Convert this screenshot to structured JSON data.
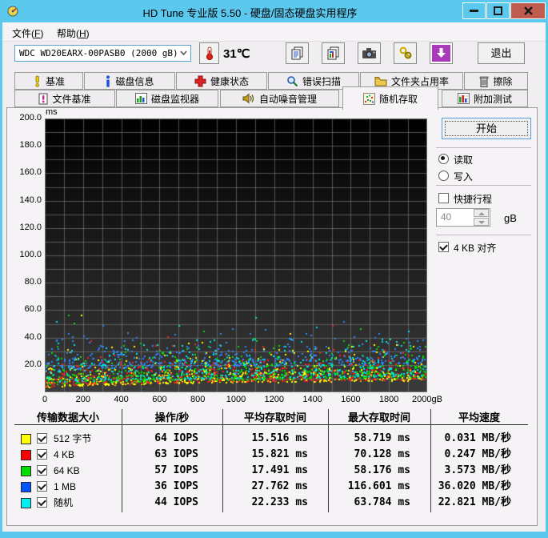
{
  "window": {
    "title": "HD Tune 专业版 5.50 - 硬盘/固态硬盘实用程序"
  },
  "menu": {
    "file": {
      "pre": "文件(",
      "key": "F",
      "post": ")"
    },
    "help": {
      "pre": "帮助(",
      "key": "H",
      "post": ")"
    }
  },
  "toolbar": {
    "drive_selector_value": "WDC WD20EARX-00PASB0 (2000 gB)",
    "temperature": "31℃",
    "exit_label": "退出"
  },
  "tabs": {
    "row1": [
      {
        "label": "基准"
      },
      {
        "label": "磁盘信息"
      },
      {
        "label": "健康状态"
      },
      {
        "label": "错误扫描"
      },
      {
        "label": "文件夹占用率"
      },
      {
        "label": "擦除"
      }
    ],
    "row2": [
      {
        "label": "文件基准"
      },
      {
        "label": "磁盘监视器"
      },
      {
        "label": "自动噪音管理"
      },
      {
        "label": "随机存取",
        "selected": true
      },
      {
        "label": "附加测试"
      }
    ]
  },
  "controls": {
    "start_label": "开始",
    "read_label": "读取",
    "write_label": "写入",
    "read_selected": true,
    "short_stroke_label": "快捷行程",
    "short_stroke_checked": false,
    "capacity_value": "40",
    "capacity_unit": "gB",
    "align_label": "4 KB 对齐",
    "align_checked": true
  },
  "chart_data": {
    "type": "scatter",
    "title": "随机存取 (Random Access) — access time vs disk position",
    "x_unit": "gB",
    "y_unit": "ms",
    "xlim": [
      0,
      2000
    ],
    "ylim": [
      0,
      200
    ],
    "x_tick_step": 200,
    "y_tick_step": 20,
    "x_grid_step": 100,
    "y_grid_step": 10,
    "x_end_label": "2000gB",
    "grid": true,
    "plot_bg_top": "#000000",
    "plot_bg_bottom": "#3b3b3b",
    "grid_color": "rgba(130,130,130,0.6)",
    "series": [
      {
        "name": "512 字节",
        "color": "#ffff00",
        "count": 520,
        "seed": 11,
        "env_start": 3.5,
        "env_end": 9,
        "exp_mean": 6.5,
        "cap": 38,
        "avg_ms": 15.516,
        "max_ms": 58.719,
        "extra_points": [
          [
            190,
            57
          ],
          [
            1280,
            43
          ],
          [
            820,
            37
          ],
          [
            1720,
            35
          ]
        ]
      },
      {
        "name": "4 KB",
        "color": "#ff2020",
        "count": 480,
        "seed": 22,
        "env_start": 4,
        "env_end": 9.5,
        "exp_mean": 6.5,
        "cap": 36,
        "avg_ms": 15.821,
        "max_ms": 70.128,
        "extra_points": [
          [
            1500,
            49
          ],
          [
            640,
            41
          ],
          [
            240,
            38
          ]
        ]
      },
      {
        "name": "64 KB",
        "color": "#00dd00",
        "count": 470,
        "seed": 33,
        "env_start": 5,
        "env_end": 11,
        "exp_mean": 7,
        "cap": 40,
        "avg_ms": 17.491,
        "max_ms": 58.176,
        "extra_points": [
          [
            120,
            57
          ],
          [
            150,
            51
          ],
          [
            830,
            45
          ],
          [
            1650,
            47
          ]
        ]
      },
      {
        "name": "1 MB",
        "color": "#2f86ff",
        "count": 400,
        "seed": 44,
        "env_start": 16,
        "env_end": 21,
        "exp_mean": 6.5,
        "cap": 44,
        "avg_ms": 27.762,
        "max_ms": 116.601,
        "extra_points": [
          [
            300,
            49
          ],
          [
            980,
            47
          ],
          [
            430,
            44
          ],
          [
            1560,
            52
          ],
          [
            1150,
            46
          ]
        ]
      },
      {
        "name": "随机",
        "color": "#00e5e5",
        "count": 430,
        "seed": 55,
        "env_start": 6.5,
        "env_end": 12,
        "exp_mean": 9,
        "cap": 40,
        "avg_ms": 22.233,
        "max_ms": 63.784,
        "extra_points": [
          [
            60,
            52
          ],
          [
            700,
            49
          ],
          [
            1900,
            45
          ],
          [
            1100,
            55
          ],
          [
            1420,
            48
          ]
        ]
      }
    ]
  },
  "table": {
    "headers": [
      "传输数据大小",
      "操作/秒",
      "平均存取时间",
      "最大存取时间",
      "平均速度"
    ],
    "rows": [
      {
        "color": "#ffff00",
        "checked": true,
        "label": "512 字节",
        "iops": "64 IOPS",
        "avg": "15.516 ms",
        "max": "58.719 ms",
        "speed": "0.031 MB/秒"
      },
      {
        "color": "#ff0000",
        "checked": true,
        "label": "4 KB",
        "iops": "63 IOPS",
        "avg": "15.821 ms",
        "max": "70.128 ms",
        "speed": "0.247 MB/秒"
      },
      {
        "color": "#00dd00",
        "checked": true,
        "label": "64 KB",
        "iops": "57 IOPS",
        "avg": "17.491 ms",
        "max": "58.176 ms",
        "speed": "3.573 MB/秒"
      },
      {
        "color": "#0055ff",
        "checked": true,
        "label": "1 MB",
        "iops": "36 IOPS",
        "avg": "27.762 ms",
        "max": "116.601 ms",
        "speed": "36.020 MB/秒"
      },
      {
        "color": "#00eeee",
        "checked": true,
        "label": "随机",
        "iops": "44 IOPS",
        "avg": "22.233 ms",
        "max": "63.784 ms",
        "speed": "22.821 MB/秒"
      }
    ]
  }
}
